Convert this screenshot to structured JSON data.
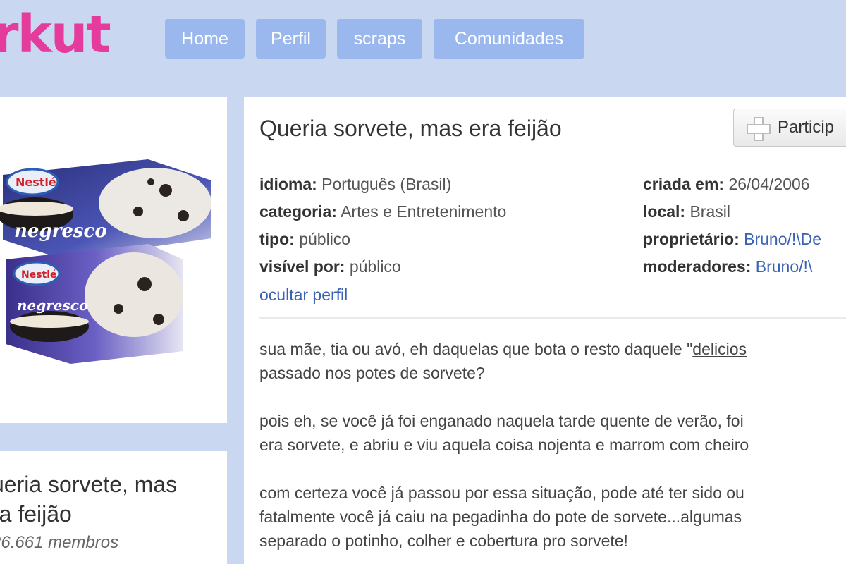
{
  "header": {
    "logo": "rkut",
    "nav": [
      {
        "label": "Home"
      },
      {
        "label": "Perfil"
      },
      {
        "label": "scraps"
      },
      {
        "label": "Comunidades"
      }
    ]
  },
  "community": {
    "title": "Queria sorvete, mas era feijão",
    "card_name_line1": "ueria sorvete, mas",
    "card_name_line2": "ra feijão",
    "members": "26.661 membros",
    "join_label": "Particip",
    "product_brand": "Nestlé",
    "product_name": "negresco"
  },
  "properties_left": [
    {
      "key": "idioma:",
      "value": "Português (Brasil)"
    },
    {
      "key": "categoria:",
      "value": "Artes e Entretenimento"
    },
    {
      "key": "tipo:",
      "value": "público"
    },
    {
      "key": "visível por:",
      "value": "público"
    }
  ],
  "properties_right": [
    {
      "key": "criada em:",
      "value": "26/04/2006"
    },
    {
      "key": "local:",
      "value": "Brasil"
    },
    {
      "key": "proprietário:",
      "value": "Bruno/!\\De"
    },
    {
      "key": "moderadores:",
      "value": "Bruno/!\\"
    }
  ],
  "hide_profile": "ocultar perfil",
  "description": {
    "p1_line1_a": "sua mãe, tia ou avó, eh daquelas que bota o resto daquele \"",
    "p1_line1_link": "delicios",
    "p1_line2": "passado nos potes de sorvete?",
    "p2_line1": "pois eh, se você já foi enganado naquela tarde quente de verão, foi",
    "p2_line2": "era sorvete, e abriu e viu aquela coisa nojenta e marrom com cheiro",
    "p3_line1": "com certeza você já passou por essa situação, pode até ter sido ou",
    "p3_line2": "fatalmente você já caiu na pegadinha do pote de sorvete...algumas",
    "p3_line3": "separado o potinho, colher e cobertura pro sorvete!"
  },
  "colors": {
    "background": "#c9d7f1",
    "logo": "#e43b9c",
    "nav_button": "#9bb8ee",
    "link": "#3a62b3"
  }
}
